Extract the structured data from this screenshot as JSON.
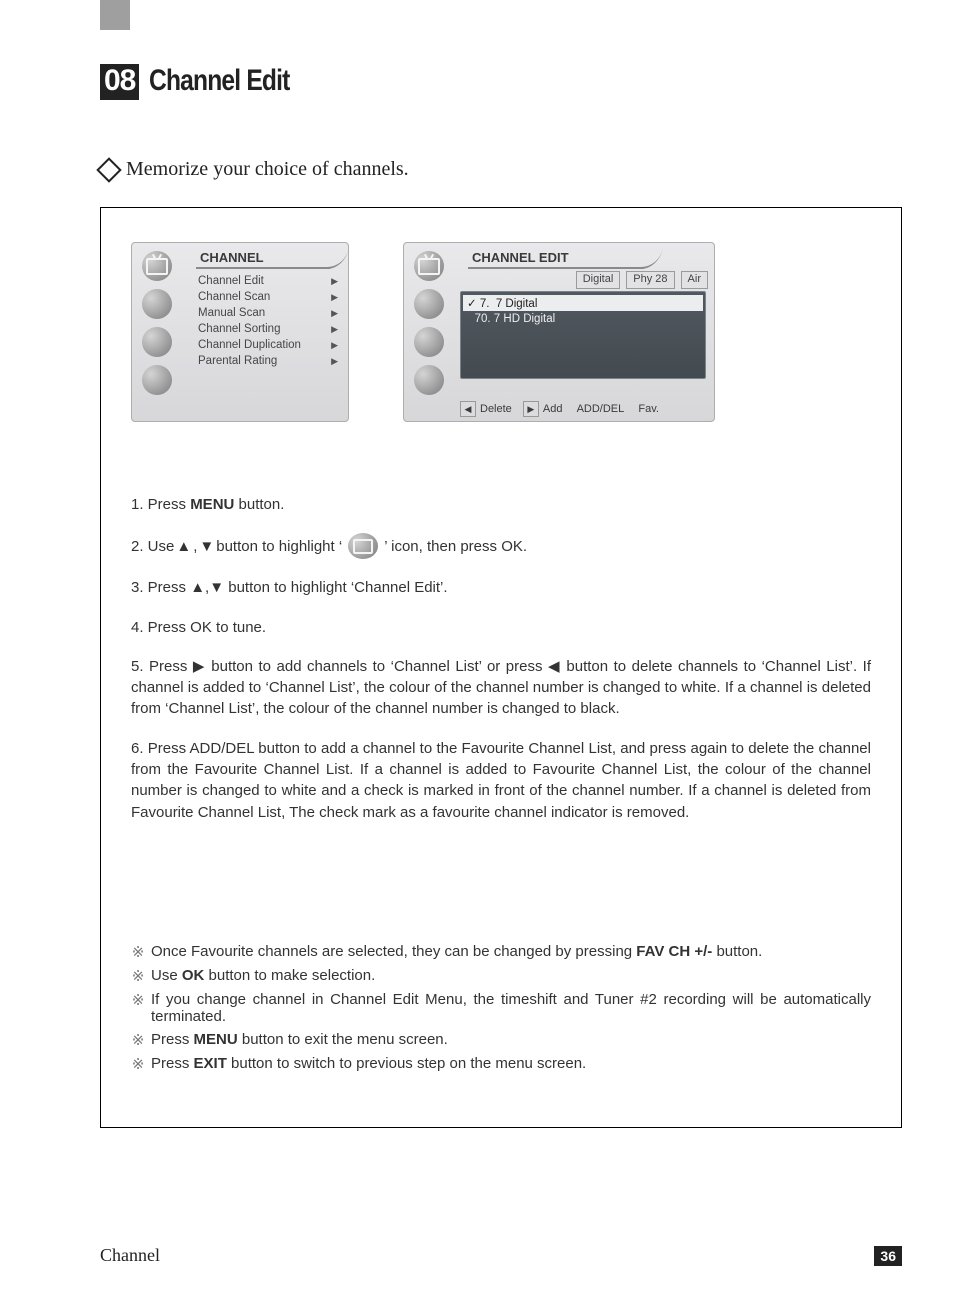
{
  "section_number": "08",
  "section_title": "Channel Edit",
  "intro": "Memorize your choice of channels.",
  "left_panel": {
    "title": "CHANNEL",
    "items": [
      "Channel Edit",
      "Channel Scan",
      "Manual Scan",
      "Channel Sorting",
      "Channel Duplication",
      "Parental Rating"
    ]
  },
  "right_panel": {
    "title": "CHANNEL EDIT",
    "pills": [
      "Digital",
      "Phy 28",
      "Air"
    ],
    "rows": [
      {
        "prefix": "✓",
        "num": "7.",
        "name": "7 Digital",
        "selected": true
      },
      {
        "prefix": "",
        "num": "70.",
        "name": "7 HD Digital",
        "selected": false
      }
    ],
    "bottom_bar": {
      "delete": "Delete",
      "add": "Add",
      "adddel": "ADD/DEL",
      "fav": "Fav."
    }
  },
  "steps": {
    "s1_a": "1. Press ",
    "s1_b": "MENU",
    "s1_c": " button.",
    "s2_a": "2. Use ",
    "s2_b": " button to highlight  ‘",
    "s2_c": "’  icon, then press OK.",
    "s3_a": "3. Press ",
    "s3_b": " button to highlight ‘Channel Edit’.",
    "s4": "4. Press OK to tune.",
    "s5_a": "5. Press ",
    "s5_b": " button to add channels to ‘Channel List’ or press ",
    "s5_c": " button to delete channels to ‘Channel List’. If channel is added to ‘Channel List’, the colour of the channel number is changed to white. If a channel is deleted from ‘Channel List’, the colour of the channel number is changed to black.",
    "s6": "6. Press ADD/DEL button to add a channel to the Favourite Channel List, and press again to delete the channel from the Favourite Channel List. If a channel is added to Favourite Channel List, the colour of the channel number is changed to white and a check is marked in front of the channel number. If a channel is deleted from Favourite Channel List, The check mark as a favourite channel indicator is removed."
  },
  "notes": {
    "n1_a": "Once Favourite channels are selected, they can be changed by pressing ",
    "n1_b": "FAV CH +/-",
    "n1_c": " button.",
    "n2_a": "Use  ",
    "n2_b": "OK",
    "n2_c": " button to make selection.",
    "n3": "If you change channel in Channel Edit Menu, the timeshift and Tuner #2 recording will be automatically terminated.",
    "n4_a": "Press ",
    "n4_b": "MENU",
    "n4_c": " button to exit the menu screen.",
    "n5_a": "Press ",
    "n5_b": "EXIT",
    "n5_c": " button to switch to previous step on the menu screen."
  },
  "footer_title": "Channel",
  "page_number": "36",
  "note_symbol": "※"
}
